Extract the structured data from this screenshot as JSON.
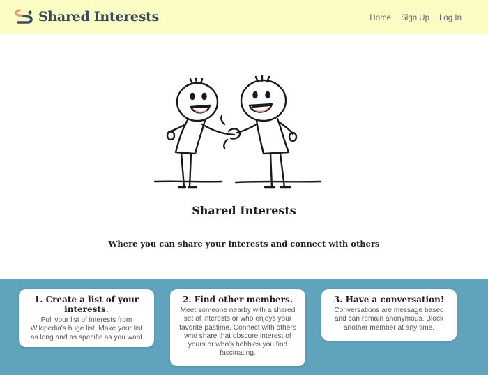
{
  "navbar": {
    "brand_name": "Shared Interests",
    "links": [
      {
        "label": "Home"
      },
      {
        "label": "Sign Up"
      },
      {
        "label": "Log In"
      }
    ]
  },
  "hero": {
    "illustration": "two-stick-figures-shaking-hands",
    "title": "Shared Interests",
    "subtitle": "Where you can share your interests and connect with others"
  },
  "features": [
    {
      "title": "1. Create a list of your interests.",
      "text": "Pull your list of interests from Wikipedia's huge list. Make your list as long and as specific as you want"
    },
    {
      "title": "2. Find other members.",
      "text": "Meet someone nearby with a shared set of interests or who enjoys your favorite pastime. Connect with others who share that obscure interest of yours or who's hobbies you find fascinating."
    },
    {
      "title": "3. Have a conversation!",
      "text": "Conversations are message based and can remain anonymous. Block another member at any time."
    }
  ],
  "colors": {
    "navbar_bg": "#fbfcc4",
    "features_bg": "#5fa3bd",
    "brand_text": "#3b4a5e",
    "logo_accent": "#e0a07a"
  }
}
